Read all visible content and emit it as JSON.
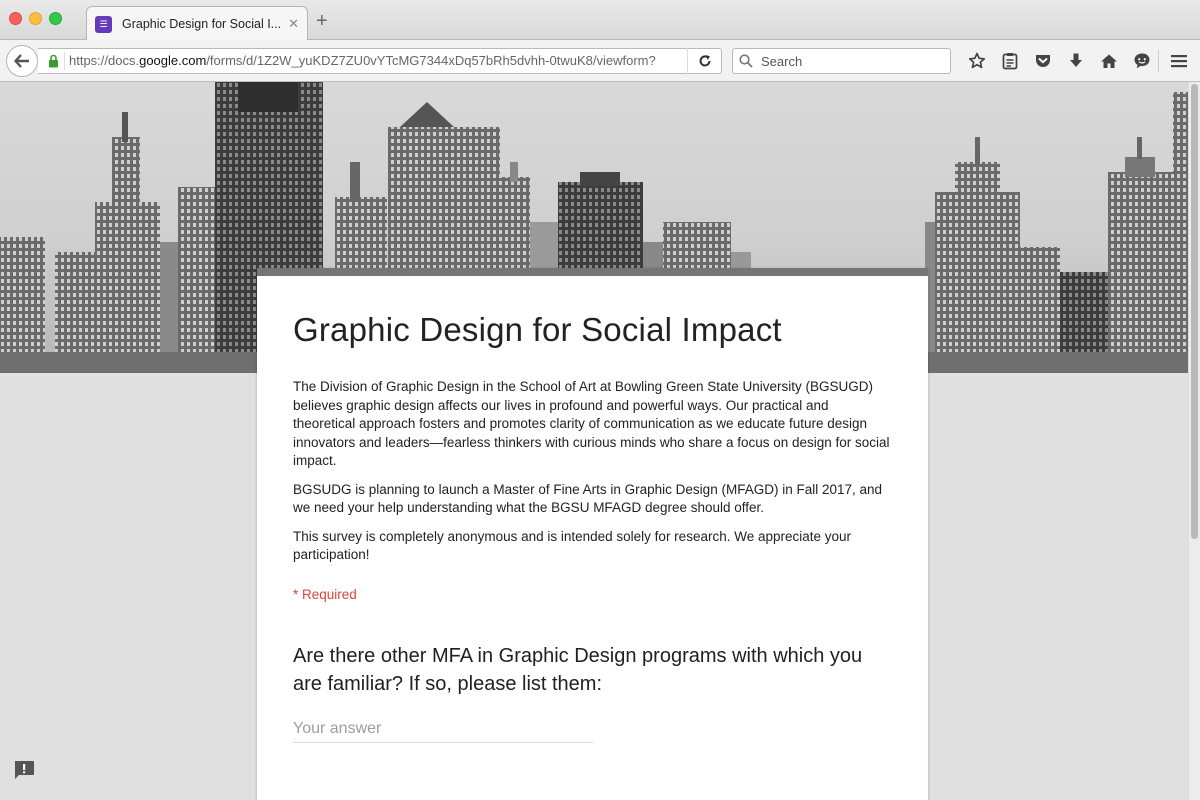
{
  "browser": {
    "tab_title": "Graphic Design for Social I...",
    "url_prefix": "https://docs.",
    "url_domain": "google.com",
    "url_path": "/forms/d/1Z2W_yuKDZ7ZU0vYTcMG7344xDq57bRh5dvhh-0twuK8/viewform?",
    "search_placeholder": "Search"
  },
  "form": {
    "title": "Graphic Design for Social Impact",
    "paragraphs": [
      "The Division of Graphic Design in the School of Art at Bowling Green State University (BGSUGD) believes graphic design affects our lives in profound and powerful ways. Our practical and theoretical approach fosters and promotes clarity of communication as we educate future design innovators and leaders—fearless thinkers with curious minds who share a focus on design for social impact.",
      "BGSUDG is planning to launch a Master of Fine Arts in Graphic Design (MFAGD) in Fall 2017, and we need your help understanding what the BGSU MFAGD degree should offer.",
      "This survey is completely anonymous and is intended solely for research. We appreciate your participation!"
    ],
    "required_note": "* Required",
    "question": "Are there other MFA in Graphic Design programs with which you are familiar? If so, please list them:",
    "answer_placeholder": "Your answer"
  },
  "colors": {
    "form_accent": "#673ab7",
    "required_red": "#db4437",
    "card_header": "#757575"
  }
}
